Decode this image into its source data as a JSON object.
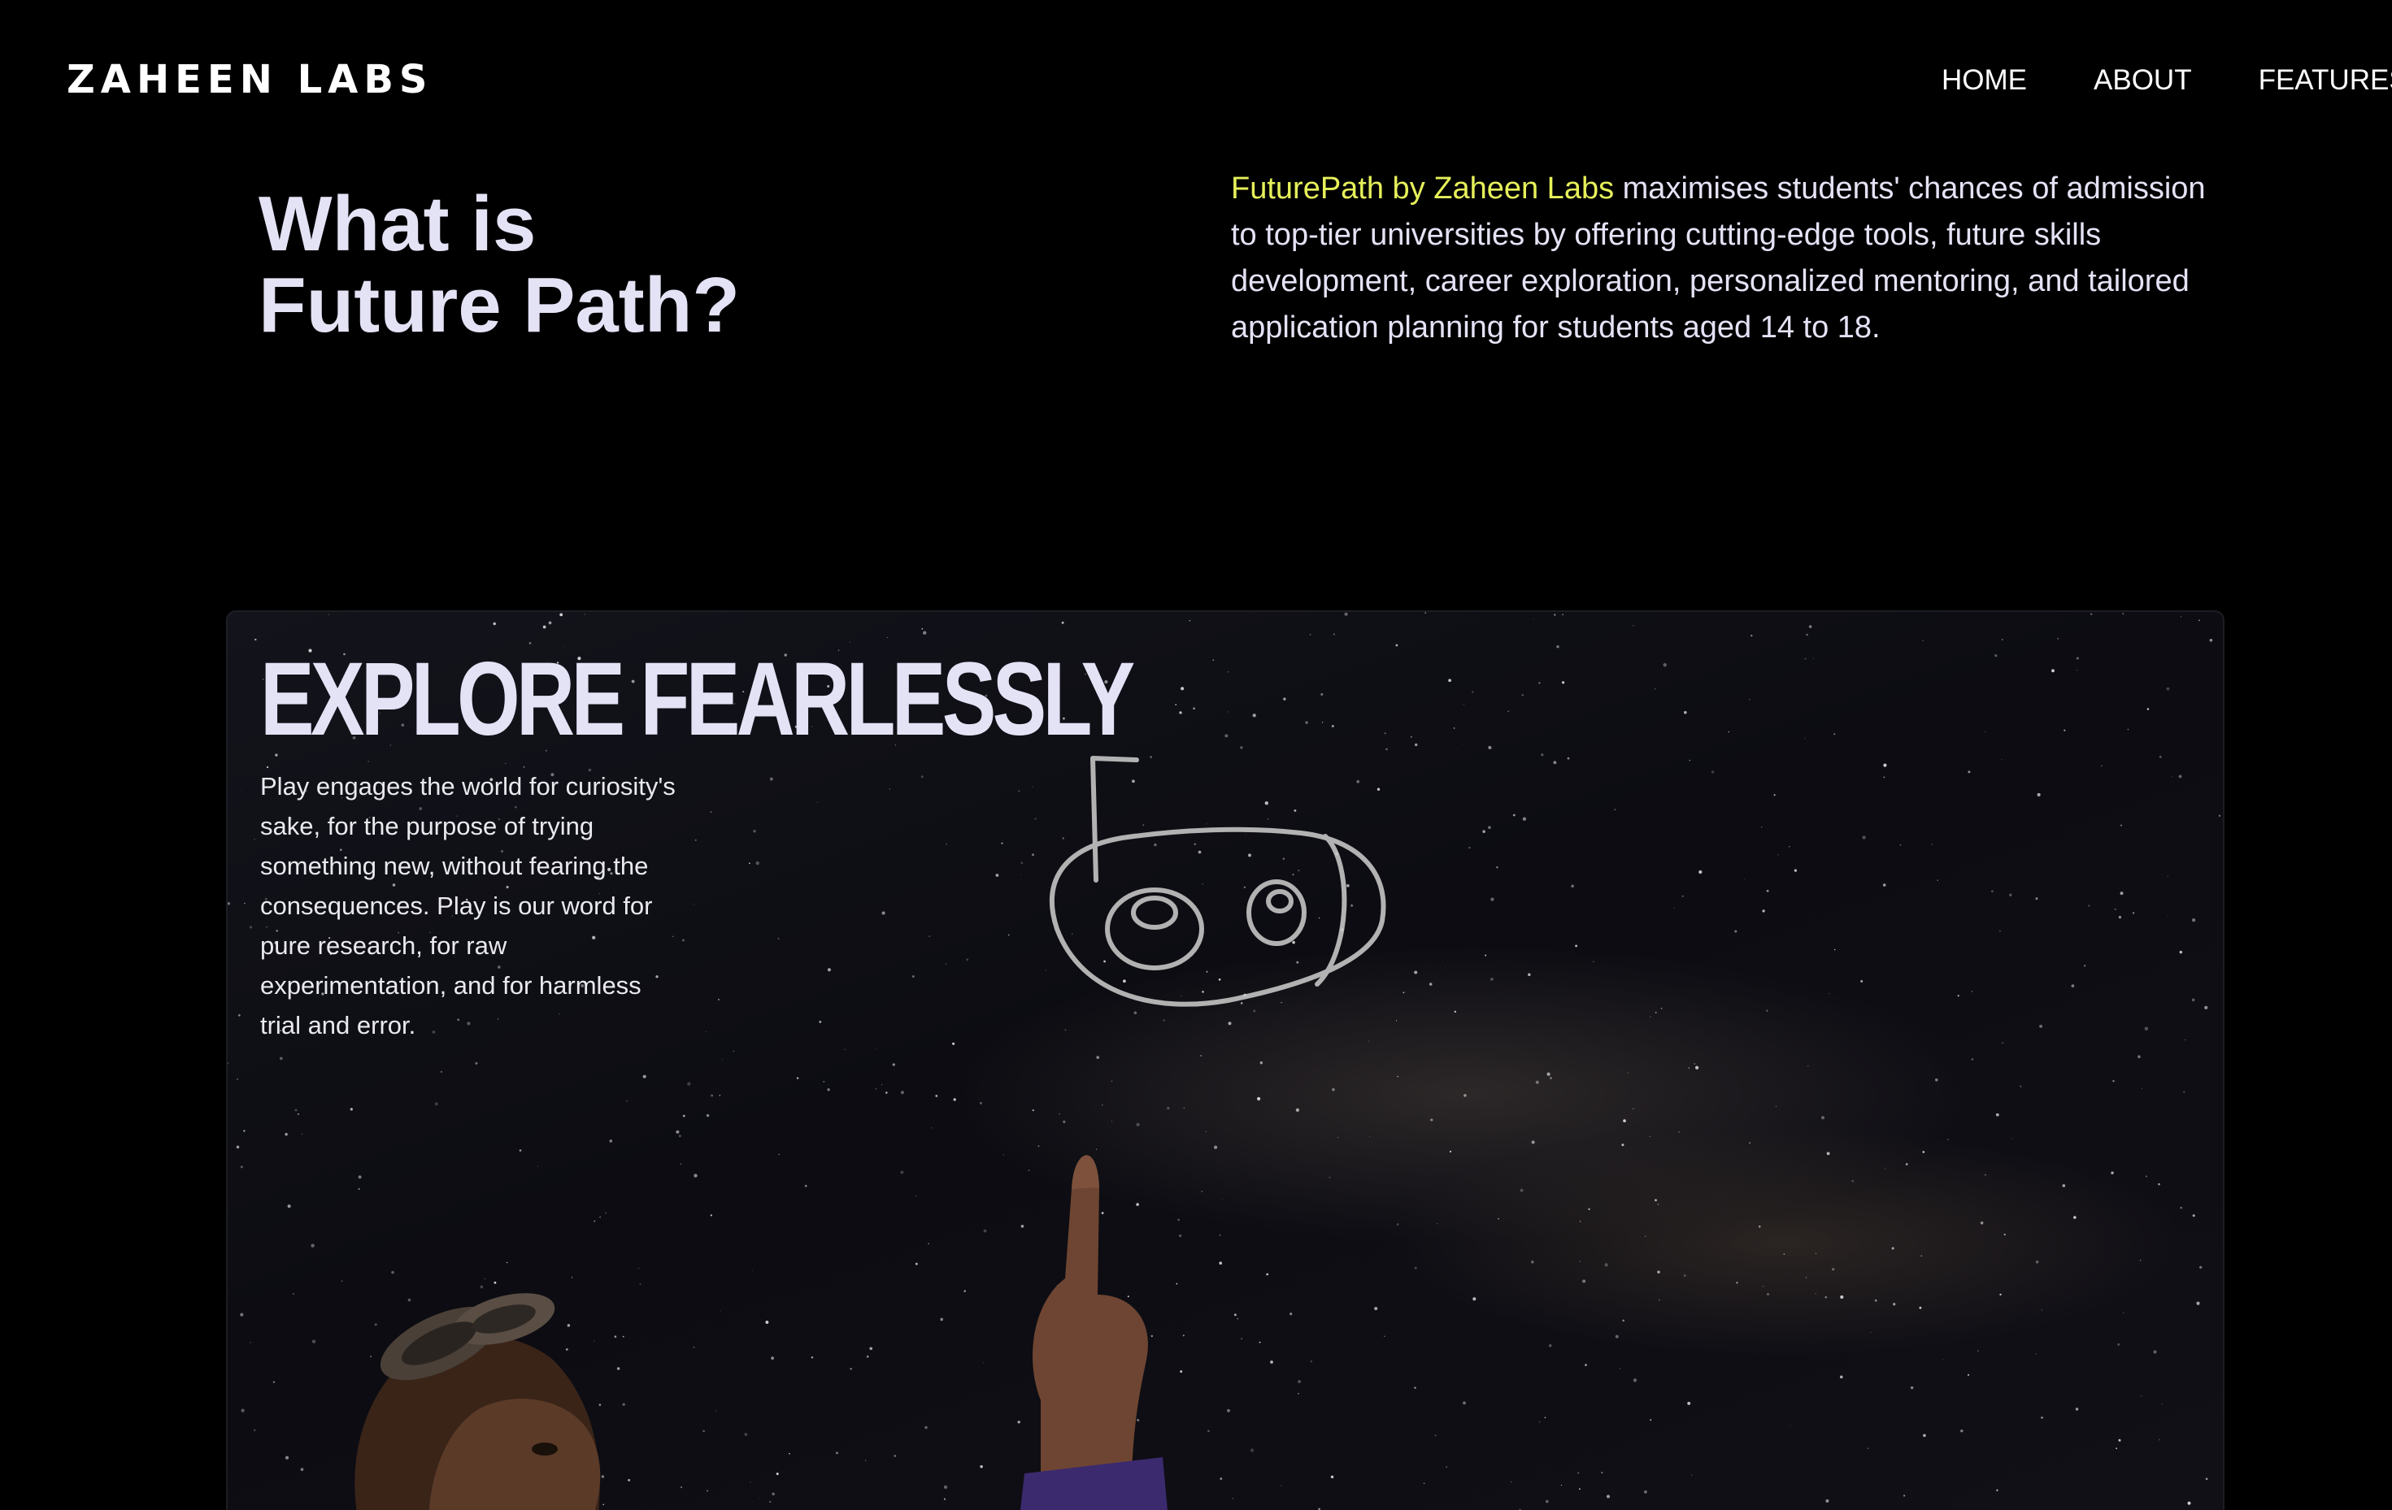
{
  "header": {
    "logo": "ZAHEEN LABS",
    "nav": [
      "HOME",
      "ABOUT",
      "FEATURES"
    ]
  },
  "intro": {
    "title_line1": "What is",
    "title_line2": "Future Path?",
    "brand": "FuturePath by Zaheen Labs",
    "description": " maximises students' chances of admission to top-tier universities by offering cutting-edge tools, future skills development, career exploration, personalized mentoring, and tailored application planning for students aged 14 to 18."
  },
  "explore": {
    "title": "EXPLORE FEARLESSLY",
    "text": "Play engages the world for curiosity's sake, for the purpose of trying something new, without fearing the consequences. Play is our word for pure research, for raw experimentation, and for harmless trial and error."
  },
  "colors": {
    "background": "#000000",
    "heading": "#e4e2f5",
    "accent": "#e6f05a",
    "nav": "#ffffff"
  }
}
